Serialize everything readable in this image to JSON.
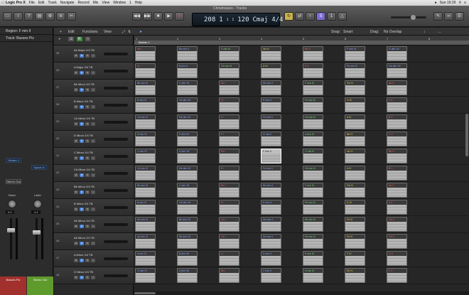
{
  "menubar": {
    "app": "Logic Pro X",
    "items": [
      "File",
      "Edit",
      "Track",
      "Navigate",
      "Record",
      "Mix",
      "View",
      "Window",
      "1",
      "Help"
    ],
    "clock": "Sun 19:29"
  },
  "window_title": "Christmases - Tracks",
  "transport": {
    "bar": "208",
    "beat": "1",
    "div": "1",
    "tick": "1",
    "tempo": "120",
    "key": "Cmaj",
    "signature": "4/4"
  },
  "inspector": {
    "region_label": "Region: F min II",
    "track_label": "Track: Basses Piz",
    "insert_a": "Vibrato 1",
    "insert_b": "Space D",
    "output": "Stereo Out",
    "read_mode": "Read",
    "latch_mode": "Latch",
    "vol_a": "0.0",
    "vol_b": "-2.1",
    "channel_a": "Basses Piz",
    "channel_b": "Stereo Out"
  },
  "tracks_toolbar": {
    "edit": "Edit",
    "functions": "Functions",
    "view": "View",
    "snap_label": "Snap:",
    "snap_value": "Smart",
    "drag_label": "Drag:",
    "drag_value": "No Overlap"
  },
  "ruler": {
    "bars": [
      "1",
      "2",
      "3",
      "4",
      "5",
      "6",
      "7",
      "8"
    ],
    "marker": "Marker 1"
  },
  "tracks": [
    {
      "num": "35",
      "name": "Ab Major  2/4 TB",
      "regions": [
        [
          "Ab I",
          "red"
        ],
        [
          "Bb min II",
          "blue"
        ],
        [
          "C min III",
          "green"
        ],
        [
          "Db IV",
          "yellow"
        ],
        [
          "Eb V",
          "red"
        ],
        [
          "F min VI",
          "blue"
        ],
        [
          "G dim VII",
          "blue"
        ]
      ]
    },
    {
      "num": "36",
      "name": "A Major  2/4 TB",
      "regions": [
        [
          "A I",
          "red"
        ],
        [
          "B min II",
          "blue"
        ],
        [
          "C# min III",
          "green"
        ],
        [
          "D IV",
          "yellow"
        ],
        [
          "E V",
          "red"
        ],
        [
          "F# min VI",
          "blue"
        ],
        [
          "G# dim VII",
          "blue"
        ]
      ]
    },
    {
      "num": "37",
      "name": "Bb Minor  2/4 TB",
      "regions": [
        [
          "Bb min VI",
          "blue"
        ],
        [
          "C dim VII",
          "blue"
        ],
        [
          "Db I",
          "red"
        ],
        [
          "Eb min II",
          "blue"
        ],
        [
          "F min III",
          "green"
        ],
        [
          "Gb IV",
          "yellow"
        ],
        [
          "Ab V",
          "red"
        ]
      ]
    },
    {
      "num": "38",
      "name": "B Minor  2/4 TB",
      "regions": [
        [
          "B min VI",
          "blue"
        ],
        [
          "C# dim VII",
          "blue"
        ],
        [
          "D I",
          "red"
        ],
        [
          "E min II",
          "blue"
        ],
        [
          "F# min III",
          "green"
        ],
        [
          "G IV",
          "yellow"
        ],
        [
          "A V",
          "red"
        ]
      ]
    },
    {
      "num": "39",
      "name": "C# Minor  2/4 TB",
      "regions": [
        [
          "C# min VI",
          "blue"
        ],
        [
          "D# dim VII",
          "blue"
        ],
        [
          "E I",
          "red"
        ],
        [
          "F# min II",
          "blue"
        ],
        [
          "G# min III",
          "green"
        ],
        [
          "A IV",
          "yellow"
        ],
        [
          "B V",
          "red"
        ]
      ]
    },
    {
      "num": "40",
      "name": "D Minor  2/4 TB",
      "regions": [
        [
          "D min VI",
          "blue"
        ],
        [
          "E dim VII",
          "blue"
        ],
        [
          "F I",
          "red"
        ],
        [
          "G min II",
          "blue"
        ],
        [
          "A min III",
          "green"
        ],
        [
          "Bb IV",
          "yellow"
        ],
        [
          "C V",
          "red"
        ]
      ]
    },
    {
      "num": "41",
      "name": "C Minor  2/4 TB",
      "regions": [
        [
          "C min VI",
          "blue"
        ],
        [
          "D dim VII",
          "blue"
        ],
        [
          "Eb I",
          "red"
        ],
        [
          "F min II",
          "blue"
        ],
        [
          "G min III",
          "green"
        ],
        [
          "Ab IV",
          "yellow"
        ],
        [
          "Bb V",
          "red"
        ]
      ]
    },
    {
      "num": "42",
      "name": "C# Minor  2/4 TB",
      "regions": [
        [
          "C# min VI",
          "blue"
        ],
        [
          "D# dim VII",
          "blue"
        ],
        [
          "E I",
          "red"
        ],
        [
          "F# min II",
          "blue"
        ],
        [
          "G# min III",
          "green"
        ],
        [
          "A IV",
          "yellow"
        ],
        [
          "B V",
          "red"
        ]
      ]
    },
    {
      "num": "43",
      "name": "Bb Minor  2/4 TB",
      "regions": [
        [
          "Bb min VI",
          "blue"
        ],
        [
          "C dim VII",
          "blue"
        ],
        [
          "Db I",
          "red"
        ],
        [
          "Eb min II",
          "blue"
        ],
        [
          "F min III",
          "green"
        ],
        [
          "Gb IV",
          "yellow"
        ],
        [
          "Ab V",
          "red"
        ]
      ]
    },
    {
      "num": "44",
      "name": "B Minor  2/4 TB",
      "regions": [
        [
          "B min VI",
          "blue"
        ],
        [
          "C# dim VII",
          "blue"
        ],
        [
          "D I",
          "red"
        ],
        [
          "E min II",
          "blue"
        ],
        [
          "F# min III",
          "green"
        ],
        [
          "G IV",
          "yellow"
        ],
        [
          "A V",
          "red"
        ]
      ]
    },
    {
      "num": "45",
      "name": "Ab Minor  2/4 TB",
      "regions": [
        [
          "Ab min VI",
          "blue"
        ],
        [
          "Bb dim VII",
          "blue"
        ],
        [
          "Cb I",
          "red"
        ],
        [
          "Db min II",
          "blue"
        ],
        [
          "Eb min III",
          "green"
        ],
        [
          "Fb IV",
          "yellow"
        ],
        [
          "Gb V",
          "red"
        ]
      ]
    },
    {
      "num": "46",
      "name": "A# Minor  2/4 TB",
      "regions": [
        [
          "A# min VI",
          "blue"
        ],
        [
          "B# dim VII",
          "blue"
        ],
        [
          "C# I",
          "red"
        ],
        [
          "D# min II",
          "blue"
        ],
        [
          "E# min III",
          "green"
        ],
        [
          "F# IV",
          "yellow"
        ],
        [
          "G# V",
          "red"
        ]
      ]
    },
    {
      "num": "47",
      "name": "A Minor  2/4 TB",
      "regions": [
        [
          "A min VI",
          "blue"
        ],
        [
          "B dim VII",
          "blue"
        ],
        [
          "C I",
          "red"
        ],
        [
          "D min II",
          "blue"
        ],
        [
          "E min III",
          "green"
        ],
        [
          "F IV",
          "yellow"
        ],
        [
          "G V",
          "red"
        ]
      ]
    },
    {
      "num": "48",
      "name": "G Minor  2/4 TB",
      "regions": [
        [
          "G min VI",
          "blue"
        ],
        [
          "A dim VII",
          "blue"
        ],
        [
          "Bb I",
          "red"
        ],
        [
          "C min II",
          "blue"
        ],
        [
          "D min III",
          "green"
        ],
        [
          "Eb IV",
          "yellow"
        ],
        [
          "F V",
          "red"
        ]
      ]
    }
  ]
}
